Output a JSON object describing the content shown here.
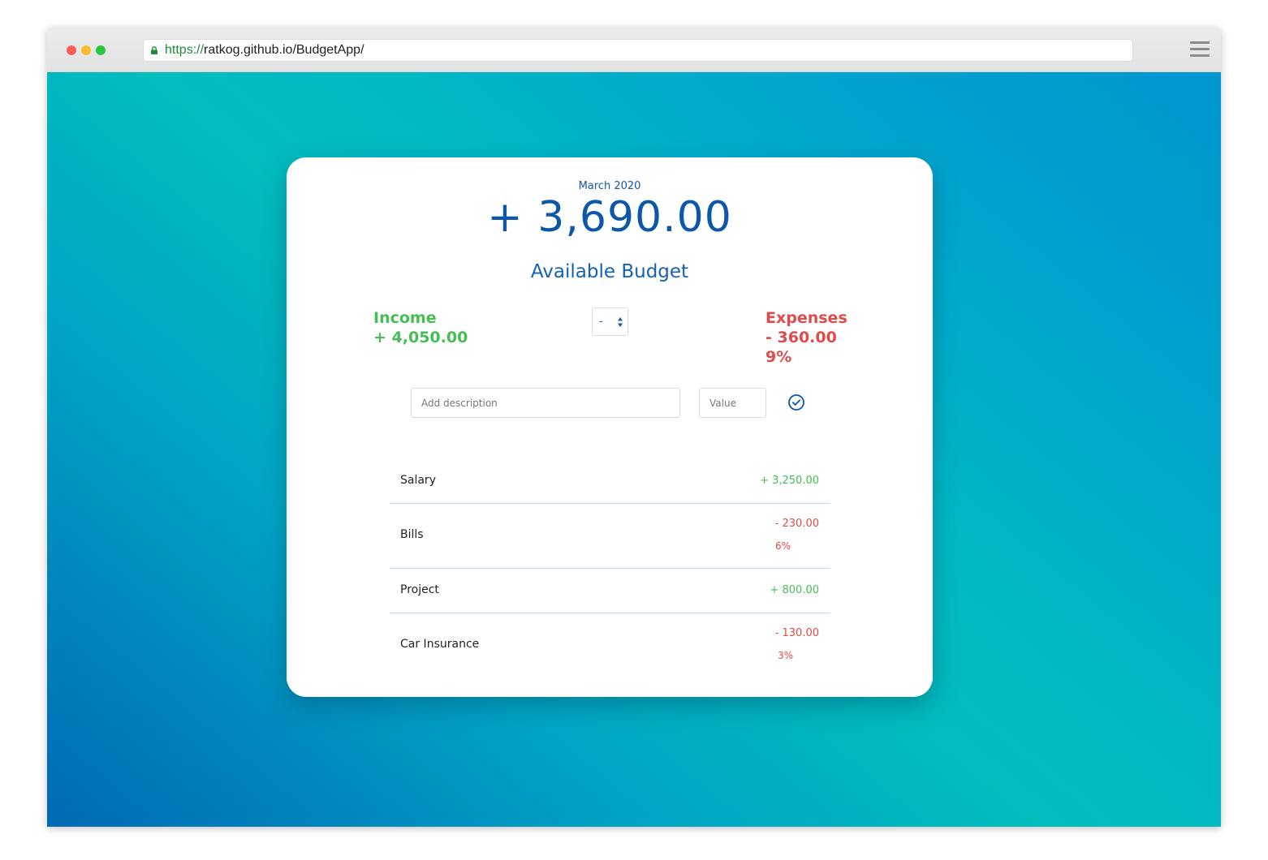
{
  "browser": {
    "url_scheme": "https://",
    "url_rest": "ratkog.github.io/BudgetApp/"
  },
  "header": {
    "month": "March 2020",
    "budget": "+ 3,690.00",
    "budget_label": "Available Budget"
  },
  "summary": {
    "income_label": "Income",
    "income_value": "+ 4,050.00",
    "expenses_label": "Expenses",
    "expenses_value": "- 360.00",
    "expenses_percent": "9%",
    "type_selected": "-"
  },
  "form": {
    "description_placeholder": "Add description",
    "value_placeholder": "Value"
  },
  "items": [
    {
      "type": "income",
      "description": "Salary",
      "value": "+ 3,250.00"
    },
    {
      "type": "expense",
      "description": "Bills",
      "value": "- 230.00",
      "percent": "6%"
    },
    {
      "type": "income",
      "description": "Project",
      "value": "+ 800.00"
    },
    {
      "type": "expense",
      "description": "Car Insurance",
      "value": "- 130.00",
      "percent": "3%"
    }
  ],
  "colors": {
    "income": "#46be55",
    "expense": "#e04b4b",
    "primary": "#0d57a8"
  },
  "icons": {
    "lock": "lock-icon",
    "menu": "hamburger-menu-icon",
    "add": "check-circle-icon",
    "select_arrows": "up-down-arrows-icon"
  }
}
